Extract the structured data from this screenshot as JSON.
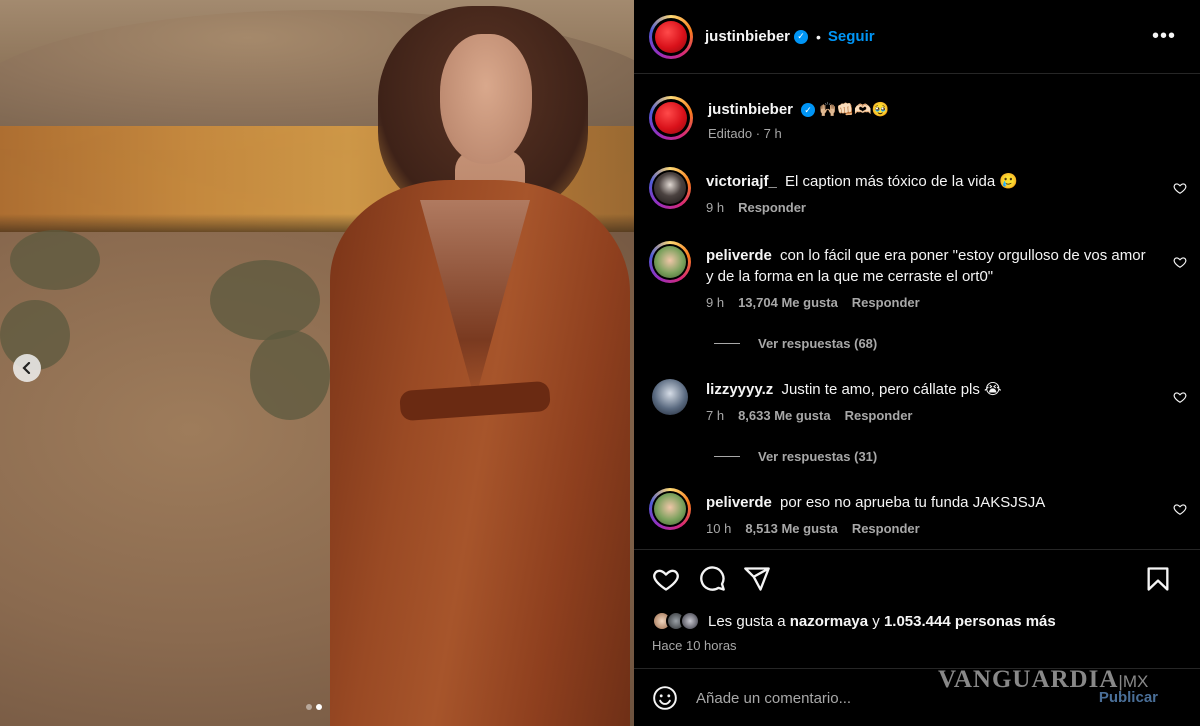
{
  "post": {
    "author": "justinbieber",
    "follow_label": "Seguir",
    "more_label": "•••",
    "caption_emojis": "🙌🏼👊🏻🫶🏻🥹",
    "caption_meta": "Editado · 7 h",
    "carousel": {
      "current_index": 2,
      "total": 2
    }
  },
  "comments": [
    {
      "user": "victoriajf_",
      "text": "El caption más tóxico de la vida 🥲",
      "time": "9 h",
      "likes": "",
      "reply_label": "Responder",
      "view_replies": ""
    },
    {
      "user": "peliverde",
      "text": "con lo fácil que era poner \"estoy orgulloso de vos amor y de la forma en la que me cerraste el ort0\"",
      "time": "9 h",
      "likes": "13,704 Me gusta",
      "reply_label": "Responder",
      "view_replies": "Ver respuestas (68)"
    },
    {
      "user": "lizzyyyy.z",
      "text": "Justin te amo, pero cállate pls 😭",
      "time": "7 h",
      "likes": "8,633 Me gusta",
      "reply_label": "Responder",
      "view_replies": "Ver respuestas (31)"
    },
    {
      "user": "peliverde",
      "text": "por eso no aprueba tu funda JAKSJSJA",
      "time": "10 h",
      "likes": "8,513 Me gusta",
      "reply_label": "Responder",
      "view_replies": ""
    }
  ],
  "likes_line": {
    "prefix": "Les gusta a",
    "user": "nazormaya",
    "connector": "y",
    "count": "1.053.444 personas más"
  },
  "posted_ago": "Hace 10 horas",
  "composer": {
    "placeholder": "Añade un comentario...",
    "publish_label": "Publicar"
  },
  "watermark": {
    "brand": "VANGUARDIA",
    "suffix": "MX"
  },
  "icons": {
    "like": "heart-icon",
    "comment": "comment-icon",
    "share": "share-icon",
    "save": "bookmark-icon",
    "emoji": "emoji-icon",
    "prev": "chevron-left-icon",
    "verified": "verified-badge-icon"
  },
  "colors": {
    "link_blue": "#0095f6",
    "muted": "#a8a8a8",
    "bg": "#000000"
  }
}
